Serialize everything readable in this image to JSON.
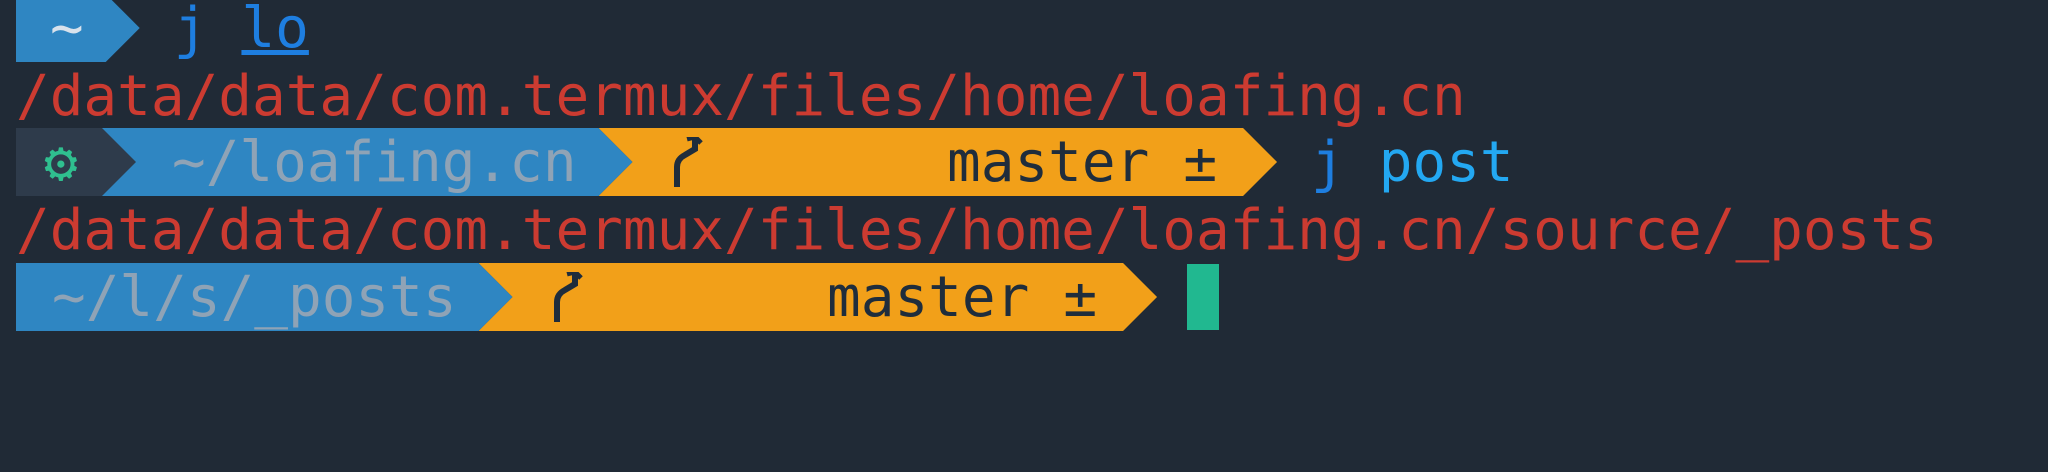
{
  "prompt1": {
    "dir": "~",
    "command": "j",
    "argument": "lo"
  },
  "output1": "/data/data/com.termux/files/home/loafing.cn",
  "prompt2": {
    "context_icon": "⚙",
    "dir": "~/loafing.cn",
    "branch_icon": "git-branch-icon",
    "branch": "master",
    "dirty_marker": "±",
    "command": "j",
    "argument": "post"
  },
  "output2": "/data/data/com.termux/files/home/loafing.cn/source/_posts",
  "prompt3": {
    "dir": "~/l/s/_posts",
    "branch_icon": "git-branch-icon",
    "branch": "master",
    "dirty_marker": "±"
  },
  "colors": {
    "background": "#202a36",
    "dir_segment": "#2f86c2",
    "git_segment": "#f2a019",
    "error_path": "#cc3b31",
    "command": "#1e7ee0",
    "cursor": "#21b890"
  }
}
